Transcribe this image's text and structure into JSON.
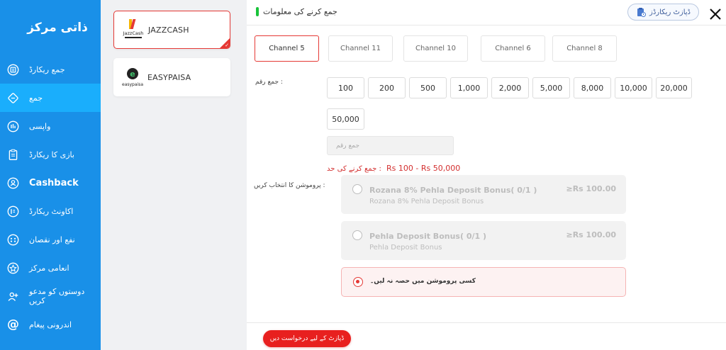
{
  "sidebar": {
    "title": "ذاتی مرکز",
    "items": [
      {
        "label": "جمع ریکارڈ",
        "icon": "record-icon",
        "active": false
      },
      {
        "label": "جمع",
        "icon": "deposit-icon",
        "active": true
      },
      {
        "label": "واپسی",
        "icon": "withdraw-icon",
        "active": false
      },
      {
        "label": "بازی کا ریکارڈ",
        "icon": "game-record-icon",
        "active": false
      },
      {
        "label": "Cashback",
        "icon": "cashback-icon",
        "active": false
      },
      {
        "label": "اکاونٹ ریکارڈ",
        "icon": "account-record-icon",
        "active": false
      },
      {
        "label": "نفع اور نقصان",
        "icon": "profit-loss-icon",
        "active": false
      },
      {
        "label": "انعامی مرکز",
        "icon": "rewards-icon",
        "active": false
      },
      {
        "label": "دوستوں کو مدعو کریں",
        "icon": "invite-friends-icon",
        "active": false
      },
      {
        "label": "اندرونی پیغام",
        "icon": "message-icon",
        "active": false
      }
    ]
  },
  "payments": [
    {
      "name": "JAZZCASH",
      "logo_text": "JazzCash",
      "selected": true
    },
    {
      "name": "EASYPAISA",
      "logo_text": "easypaisa",
      "selected": false
    }
  ],
  "header": {
    "title": "جمع کرنے کی معلومات",
    "records_button": "ڈپازٹ ریکارڈز"
  },
  "channels": [
    {
      "label": "Channel 5",
      "selected": true
    },
    {
      "label": "Channel 11",
      "selected": false
    },
    {
      "label": "Channel 10",
      "selected": false
    },
    {
      "label": "Channel 6",
      "selected": false
    },
    {
      "label": "Channel 8",
      "selected": false
    }
  ],
  "amount": {
    "label": "جمع رقم :",
    "presets": [
      "100",
      "200",
      "500",
      "1,000",
      "2,000",
      "5,000",
      "8,000",
      "10,000",
      "20,000",
      "50,000"
    ],
    "placeholder": "جمع رقم",
    "range_label": "جمع کرنے کی حد :",
    "range_value": "Rs  100 - Rs  50,000"
  },
  "promotion": {
    "label": "پروموشن کا انتخاب کریں :",
    "options": [
      {
        "title": "Rozana 8% Pehla Deposit Bonus( 0/1 )",
        "subtitle": "Rozana 8% Pehla Deposit Bonus",
        "amount": "≥Rs  100.00"
      },
      {
        "title": "Pehla Deposit Bonus( 0/1 )",
        "subtitle": "Pehla Deposit Bonus",
        "amount": "≥Rs  100.00"
      }
    ],
    "none_label": "کسی پروموشن میں حصہ نہ لیں۔"
  },
  "footer": {
    "submit_label": "ڈپازٹ کے لیے درخواست دیں"
  },
  "colors": {
    "sidebar": "#1990e8",
    "sidebar_active": "#1aaefc",
    "accent_red": "#e53935",
    "submit": "#e8201f"
  }
}
